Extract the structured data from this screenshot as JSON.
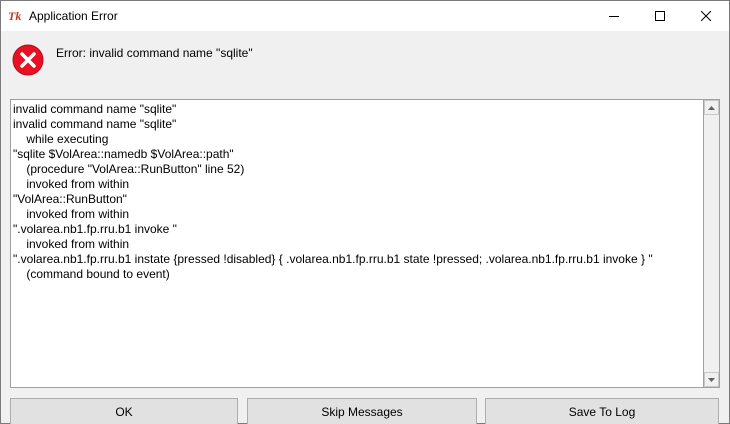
{
  "window": {
    "title": "Application Error",
    "app_icon": "tk-icon"
  },
  "controls": {
    "minimize_icon": "minimize-icon",
    "maximize_icon": "maximize-icon",
    "close_icon": "close-icon"
  },
  "error": {
    "icon": "error-icon",
    "message": "Error: invalid command name \"sqlite\""
  },
  "details": {
    "lines": [
      "invalid command name \"sqlite\"",
      "invalid command name \"sqlite\"",
      "    while executing",
      "\"sqlite $VolArea::namedb $VolArea::path\"",
      "    (procedure \"VolArea::RunButton\" line 52)",
      "    invoked from within",
      "\"VolArea::RunButton\"",
      "    invoked from within",
      "\".volarea.nb1.fp.rru.b1 invoke \"",
      "    invoked from within",
      "\".volarea.nb1.fp.rru.b1 instate {pressed !disabled} { .volarea.nb1.fp.rru.b1 state !pressed; .volarea.nb1.fp.rru.b1 invoke } \"",
      "    (command bound to event)"
    ]
  },
  "buttons": {
    "ok": "OK",
    "skip": "Skip Messages",
    "log": "Save To Log"
  },
  "colors": {
    "error_red": "#e81123",
    "titlebar_bg": "#ffffff",
    "window_bg": "#f0f0f0",
    "button_bg": "#e1e1e1"
  }
}
